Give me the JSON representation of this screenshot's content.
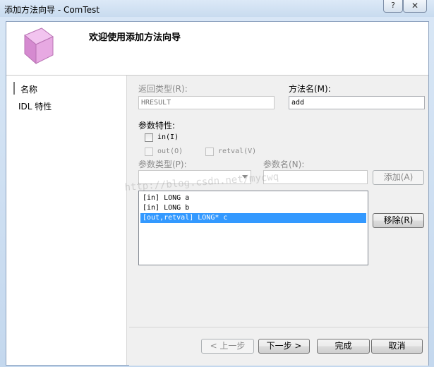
{
  "window": {
    "title": "添加方法向导 - ComTest",
    "close_glyph": "✕"
  },
  "header": {
    "title": "欢迎使用添加方法向导"
  },
  "nav": {
    "items": [
      {
        "label": "名称"
      },
      {
        "label": "IDL 特性"
      }
    ]
  },
  "form": {
    "return_type_label": "返回类型(R):",
    "return_type_value": "HRESULT",
    "method_name_label": "方法名(M):",
    "method_name_value": "add",
    "param_attr_label": "参数特性:",
    "in_label": "in(I)",
    "out_label": "out(O)",
    "retval_label": "retval(V)",
    "param_type_label": "参数类型(P):",
    "param_type_value": "",
    "param_name_label": "参数名(N):",
    "param_name_value": "",
    "add_button": "添加(A)",
    "remove_button": "移除(R)"
  },
  "params": [
    {
      "text": "[in] LONG a",
      "selected": false
    },
    {
      "text": "[in] LONG b",
      "selected": false
    },
    {
      "text": "[out,retval] LONG* c",
      "selected": true
    }
  ],
  "watermark": "http://blog.csdn.net/mycwq",
  "footer": {
    "prev_button": "< 上一步",
    "next_button": "下一步 >",
    "finish_button": "完成",
    "cancel_button": "取消"
  },
  "colors": {
    "selection": "#3399ff",
    "icon": "#d58ad0"
  }
}
